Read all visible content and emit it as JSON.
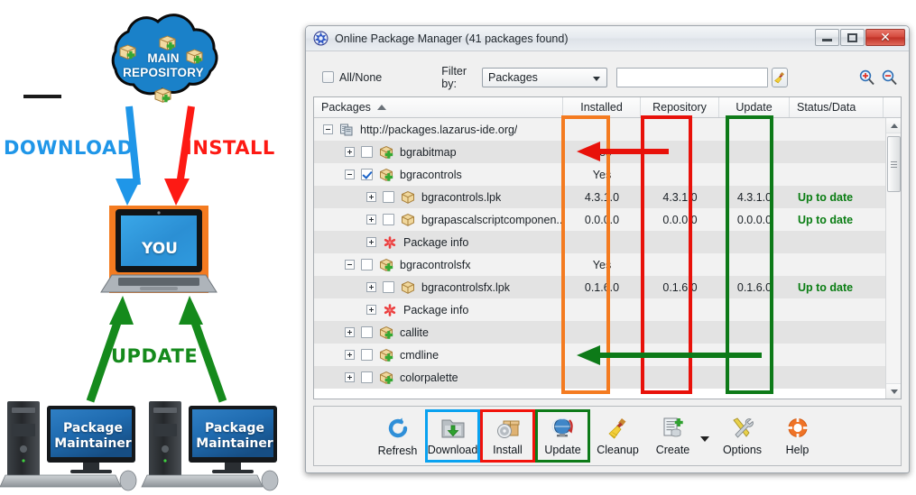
{
  "diagram": {
    "cloud": {
      "line1": "MAIN",
      "line2": "REPOSITORY"
    },
    "label_download": "DOWNLOAD",
    "label_install": "INSTALL",
    "label_update": "UPDATE",
    "laptop_label": "YOU",
    "maintainer_left": "Package\nMaintainer",
    "maintainer_left_l1": "Package",
    "maintainer_left_l2": "Maintainer",
    "maintainer_right_l1": "Package",
    "maintainer_right_l2": "Maintainer",
    "colors": {
      "download": "#1f96e8",
      "install": "#fd1a14",
      "update": "#158a1c",
      "cloud": "#1a81c9",
      "laptop_highlight": "#f47b20"
    }
  },
  "window": {
    "title": "Online Package Manager (41 packages found)",
    "icon": "lazarus-app-icon",
    "buttons": {
      "minimize": "minimize-icon",
      "maximize": "maximize-icon",
      "close": "close-icon"
    }
  },
  "filterbar": {
    "all_none_label": "All/None",
    "all_none_checked": false,
    "filter_by_label": "Filter by:",
    "filter_value": "Packages",
    "filter_options": [
      "Packages"
    ],
    "search_value": "",
    "search_placeholder": "",
    "clear_icon": "broom-icon",
    "zoom_in_icon": "zoom-in-icon",
    "zoom_out_icon": "zoom-out-icon"
  },
  "grid": {
    "columns": [
      {
        "label": "Packages",
        "sorted": true
      },
      {
        "label": "Installed"
      },
      {
        "label": "Repository"
      },
      {
        "label": "Update"
      },
      {
        "label": "Status/Data"
      }
    ],
    "rows": [
      {
        "indent": 0,
        "expander": "minus",
        "checkbox": null,
        "icon": "repository-icon",
        "name": "http://packages.lazarus-ide.org/",
        "installed": "",
        "repository": "",
        "update": "",
        "status": ""
      },
      {
        "indent": 1,
        "expander": "plus",
        "checkbox": false,
        "icon": "package-plus-icon",
        "name": "bgrabitmap",
        "installed": "Yes",
        "repository": "",
        "update": "",
        "status": ""
      },
      {
        "indent": 1,
        "expander": "minus",
        "checkbox": true,
        "icon": "package-plus-icon",
        "name": "bgracontrols",
        "installed": "Yes",
        "repository": "",
        "update": "",
        "status": ""
      },
      {
        "indent": 2,
        "expander": "plus",
        "checkbox": false,
        "icon": "package-icon",
        "name": "bgracontrols.lpk",
        "installed": "4.3.1.0",
        "repository": "4.3.1.0",
        "update": "4.3.1.0",
        "status": "Up to date"
      },
      {
        "indent": 2,
        "expander": "plus",
        "checkbox": false,
        "icon": "package-icon",
        "name": "bgrapascalscriptcomponen...",
        "installed": "0.0.0.0",
        "repository": "0.0.0.0",
        "update": "0.0.0.0",
        "status": "Up to date"
      },
      {
        "indent": 2,
        "expander": "plus",
        "checkbox": null,
        "icon": "asterisk-icon",
        "name": "Package info",
        "installed": "",
        "repository": "",
        "update": "",
        "status": ""
      },
      {
        "indent": 1,
        "expander": "minus",
        "checkbox": false,
        "icon": "package-plus-icon",
        "name": "bgracontrolsfx",
        "installed": "Yes",
        "repository": "",
        "update": "",
        "status": ""
      },
      {
        "indent": 2,
        "expander": "plus",
        "checkbox": false,
        "icon": "package-icon",
        "name": "bgracontrolsfx.lpk",
        "installed": "0.1.6.0",
        "repository": "0.1.6.0",
        "update": "0.1.6.0",
        "status": "Up to date"
      },
      {
        "indent": 2,
        "expander": "plus",
        "checkbox": null,
        "icon": "asterisk-icon",
        "name": "Package info",
        "installed": "",
        "repository": "",
        "update": "",
        "status": ""
      },
      {
        "indent": 1,
        "expander": "plus",
        "checkbox": false,
        "icon": "package-plus-icon",
        "name": "callite",
        "installed": "",
        "repository": "",
        "update": "",
        "status": ""
      },
      {
        "indent": 1,
        "expander": "plus",
        "checkbox": false,
        "icon": "package-plus-icon",
        "name": "cmdline",
        "installed": "",
        "repository": "",
        "update": "",
        "status": ""
      },
      {
        "indent": 1,
        "expander": "plus",
        "checkbox": false,
        "icon": "package-plus-icon",
        "name": "colorpalette",
        "installed": "",
        "repository": "",
        "update": "",
        "status": ""
      }
    ]
  },
  "toolbar": {
    "refresh": "Refresh",
    "download": "Download",
    "install": "Install",
    "update": "Update",
    "cleanup": "Cleanup",
    "create": "Create",
    "options": "Options",
    "help": "Help"
  },
  "annotations": {
    "installed_box_color": "#f47b20",
    "repository_box_color": "#e8110a",
    "update_box_color": "#0d7a18",
    "red_arrow_label": "install-arrow-repository-to-installed",
    "green_arrow_label": "update-arrow-update-to-installed",
    "download_box_color": "#0aa2f0"
  }
}
